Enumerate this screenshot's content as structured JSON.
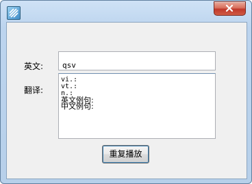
{
  "window": {
    "icon": "app-stripes-icon",
    "close_icon": "close-icon"
  },
  "form": {
    "english_label": "英文:",
    "english_value": "qsv",
    "translation_label": "翻译:",
    "translation_lines": [
      "vi.:",
      "vt.:",
      "n.:",
      "英文例句:",
      "中文例句:"
    ],
    "replay_button": "重复播放"
  },
  "colors": {
    "close_button": "#c0392b",
    "title_bar": "#bcd4ee",
    "client_bg": "#f0f0f0"
  }
}
